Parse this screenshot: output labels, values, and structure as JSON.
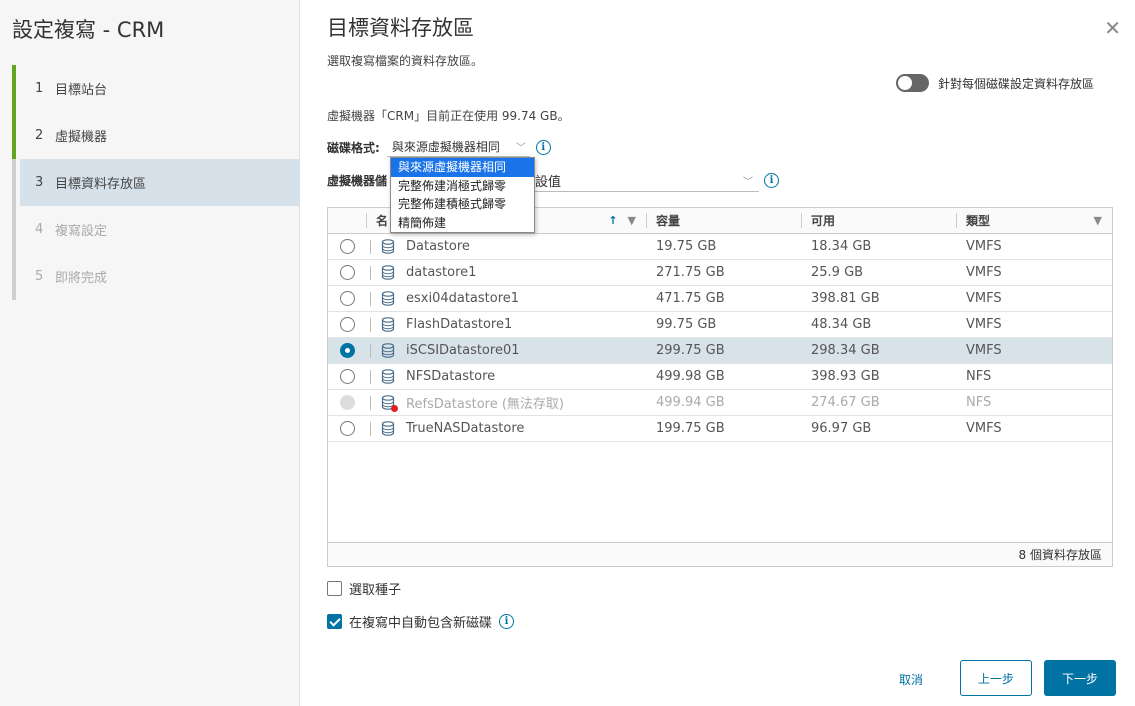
{
  "wizard": {
    "title": "設定複寫 - CRM",
    "steps": [
      {
        "num": "1",
        "label": "目標站台"
      },
      {
        "num": "2",
        "label": "虛擬機器"
      },
      {
        "num": "3",
        "label": "目標資料存放區"
      },
      {
        "num": "4",
        "label": "複寫設定"
      },
      {
        "num": "5",
        "label": "即將完成"
      }
    ]
  },
  "page": {
    "title": "目標資料存放區",
    "subtitle": "選取複寫檔案的資料存放區。",
    "toggle_label": "針對每個磁碟設定資料存放區",
    "usage_text": "虛擬機器「CRM」目前正在使用 99.74 GB。"
  },
  "disk_format": {
    "label": "磁碟格式:",
    "value": "與來源虛擬機器相同",
    "options": [
      "與來源虛擬機器相同",
      "完整佈建消極式歸零",
      "完整佈建積極式歸零",
      "精簡佈建"
    ]
  },
  "vm_storage_policy": {
    "label": "虛擬機器儲",
    "value": "設值"
  },
  "grid": {
    "headers": {
      "name": "名",
      "capacity": "容量",
      "free": "可用",
      "type": "類型"
    },
    "rows": [
      {
        "name": "Datastore",
        "capacity": "19.75 GB",
        "free": "18.34 GB",
        "type": "VMFS",
        "state": "normal"
      },
      {
        "name": "datastore1",
        "capacity": "271.75 GB",
        "free": "25.9 GB",
        "type": "VMFS",
        "state": "normal"
      },
      {
        "name": "esxi04datastore1",
        "capacity": "471.75 GB",
        "free": "398.81 GB",
        "type": "VMFS",
        "state": "normal"
      },
      {
        "name": "FlashDatastore1",
        "capacity": "99.75 GB",
        "free": "48.34 GB",
        "type": "VMFS",
        "state": "normal"
      },
      {
        "name": "iSCSIDatastore01",
        "capacity": "299.75 GB",
        "free": "298.34 GB",
        "type": "VMFS",
        "state": "selected"
      },
      {
        "name": "NFSDatastore",
        "capacity": "499.98 GB",
        "free": "398.93 GB",
        "type": "NFS",
        "state": "normal"
      },
      {
        "name": "RefsDatastore (無法存取)",
        "capacity": "499.94 GB",
        "free": "274.67 GB",
        "type": "NFS",
        "state": "disabled"
      },
      {
        "name": "TrueNASDatastore",
        "capacity": "199.75 GB",
        "free": "96.97 GB",
        "type": "VMFS",
        "state": "normal"
      }
    ],
    "footer": "8 個資料存放區"
  },
  "options": {
    "select_seeds": "選取種子",
    "auto_include": "在複寫中自動包含新磁碟"
  },
  "buttons": {
    "cancel": "取消",
    "back": "上一步",
    "next": "下一步"
  }
}
